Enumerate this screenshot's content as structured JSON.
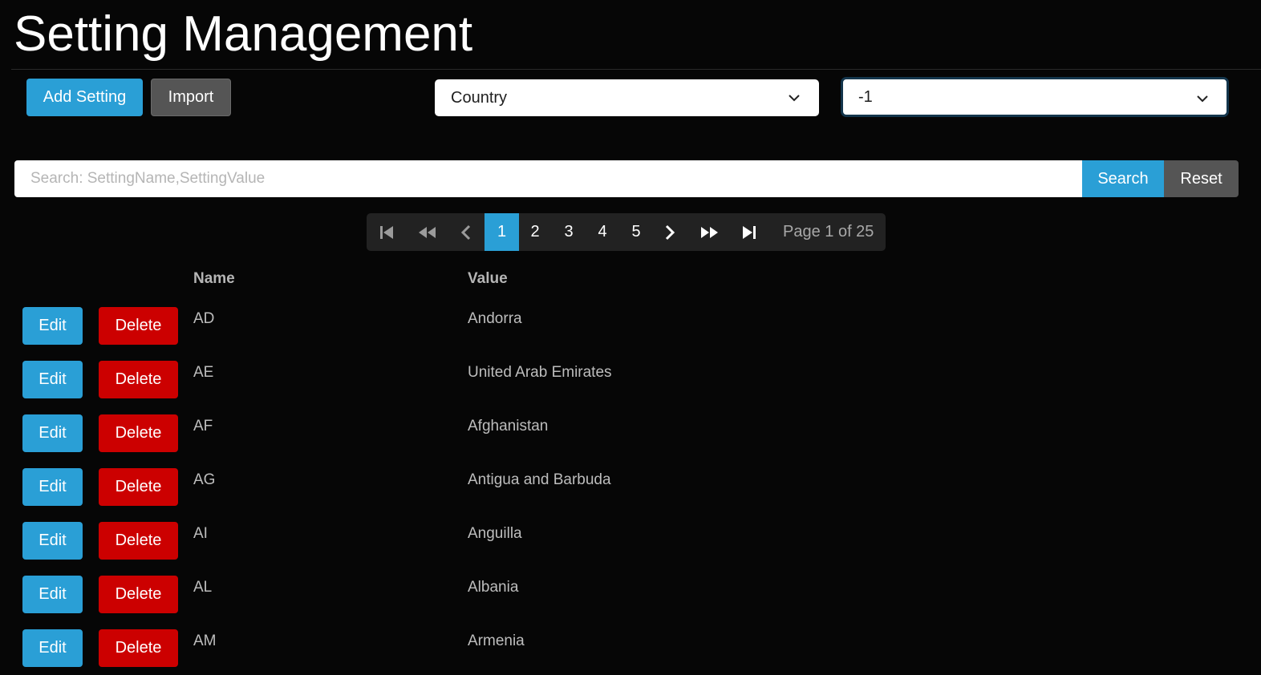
{
  "page_title": "Setting Management",
  "toolbar": {
    "add_label": "Add Setting",
    "import_label": "Import"
  },
  "filters": {
    "category_selected": "Country",
    "value_selected": "-1"
  },
  "search": {
    "placeholder": "Search: SettingName,SettingValue",
    "value": "",
    "search_label": "Search",
    "reset_label": "Reset"
  },
  "pagination": {
    "pages": [
      "1",
      "2",
      "3",
      "4",
      "5"
    ],
    "current_page": "1",
    "info": "Page 1 of 25"
  },
  "table": {
    "headers": {
      "name": "Name",
      "value": "Value"
    },
    "edit_label": "Edit",
    "delete_label": "Delete",
    "rows": [
      {
        "name": "AD",
        "value": "Andorra"
      },
      {
        "name": "AE",
        "value": "United Arab Emirates"
      },
      {
        "name": "AF",
        "value": "Afghanistan"
      },
      {
        "name": "AG",
        "value": "Antigua and Barbuda"
      },
      {
        "name": "AI",
        "value": "Anguilla"
      },
      {
        "name": "AL",
        "value": "Albania"
      },
      {
        "name": "AM",
        "value": "Armenia"
      }
    ]
  },
  "colors": {
    "background": "#060606",
    "primary": "#2a9fd6",
    "secondary": "#555555",
    "danger": "#cc0000"
  }
}
